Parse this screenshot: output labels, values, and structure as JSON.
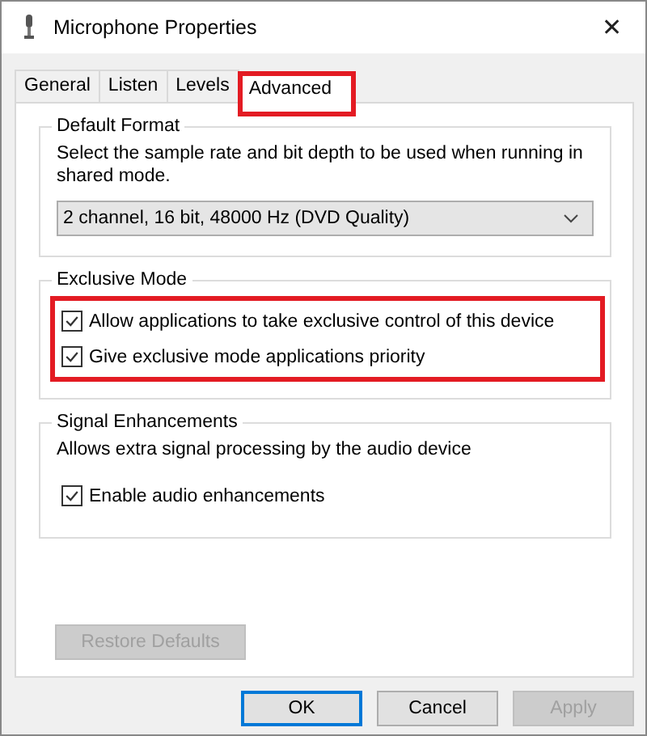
{
  "window": {
    "title": "Microphone Properties",
    "close": "✕"
  },
  "tabs": [
    {
      "label": "General",
      "selected": false,
      "highlighted": false
    },
    {
      "label": "Listen",
      "selected": false,
      "highlighted": false
    },
    {
      "label": "Levels",
      "selected": false,
      "highlighted": false
    },
    {
      "label": "Advanced",
      "selected": true,
      "highlighted": true
    }
  ],
  "default_format": {
    "title": "Default Format",
    "description": "Select the sample rate and bit depth to be used when running in shared mode.",
    "dropdown": {
      "value": "2 channel, 16 bit, 48000 Hz (DVD Quality)"
    }
  },
  "exclusive_mode": {
    "title": "Exclusive Mode",
    "highlighted": true,
    "options": [
      {
        "label": "Allow applications to take exclusive control of this device",
        "checked": true
      },
      {
        "label": "Give exclusive mode applications priority",
        "checked": true
      }
    ]
  },
  "signal_enhancements": {
    "title": "Signal Enhancements",
    "description": "Allows extra signal processing by the audio device",
    "options": [
      {
        "label": "Enable audio enhancements",
        "checked": true
      }
    ]
  },
  "restore_button": {
    "label": "Restore Defaults",
    "disabled": true
  },
  "buttons": [
    {
      "label": "OK",
      "default": true,
      "disabled": false
    },
    {
      "label": "Cancel",
      "default": false,
      "disabled": false
    },
    {
      "label": "Apply",
      "default": false,
      "disabled": true
    }
  ]
}
